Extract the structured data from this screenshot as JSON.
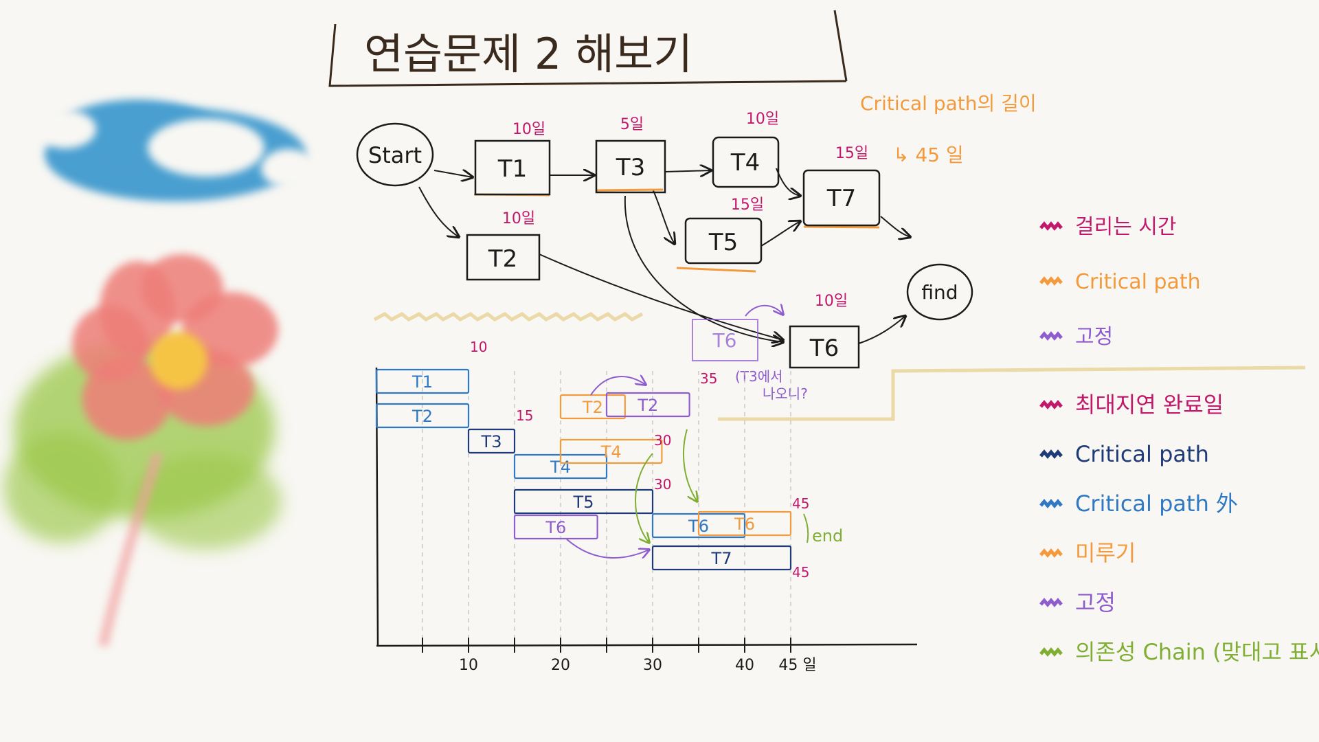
{
  "title": "연습문제 2 해보기",
  "nodes": [
    {
      "id": "start",
      "label": "Start"
    },
    {
      "id": "t1",
      "label": "T1",
      "duration": "10일"
    },
    {
      "id": "t2",
      "label": "T2",
      "duration": "10일"
    },
    {
      "id": "t3",
      "label": "T3",
      "duration": "5일"
    },
    {
      "id": "t4",
      "label": "T4",
      "duration": "10일"
    },
    {
      "id": "t5",
      "label": "T5",
      "duration": "15일"
    },
    {
      "id": "t6",
      "label": "T6",
      "duration": "10일"
    },
    {
      "id": "t6_shadow",
      "label": "T6"
    },
    {
      "id": "t7",
      "label": "T7",
      "duration": "15일"
    },
    {
      "id": "end",
      "label": "find"
    }
  ],
  "edges": [
    [
      "start",
      "t1"
    ],
    [
      "start",
      "t2"
    ],
    [
      "t1",
      "t3"
    ],
    [
      "t3",
      "t4"
    ],
    [
      "t3",
      "t5"
    ],
    [
      "t4",
      "t7"
    ],
    [
      "t5",
      "t7"
    ],
    [
      "t2",
      "t6"
    ],
    [
      "t3",
      "t6"
    ],
    [
      "t7",
      "end"
    ],
    [
      "t6",
      "end"
    ]
  ],
  "critical_note": {
    "line1": "Critical path의 길이",
    "line2": "↳ 45 일"
  },
  "t6_note": {
    "line1": "(T3에서",
    "line2": "나오니?"
  },
  "legend_top": [
    {
      "color": "#c2186b",
      "label": "걸리는 시간"
    },
    {
      "color": "#f39a3c",
      "label": "Critical path"
    },
    {
      "color": "#8e5ccf",
      "label": "고정"
    }
  ],
  "legend_bottom": [
    {
      "color": "#c2186b",
      "label": "최대지연 완료일"
    },
    {
      "color": "#1f3a78",
      "label": "Critical path"
    },
    {
      "color": "#2f78c4",
      "label": "Critical path 外"
    },
    {
      "color": "#f39a3c",
      "label": "미루기"
    },
    {
      "color": "#8e5ccf",
      "label": "고정"
    },
    {
      "color": "#7fae33",
      "label": "의존성 Chain (맞대고 표시)"
    }
  ],
  "gantt": {
    "x_ticks": [
      "10",
      "20",
      "30",
      "40",
      "45 일"
    ],
    "bars": [
      {
        "label": "T1",
        "color": "#2f78c4"
      },
      {
        "label": "T2",
        "color": "#2f78c4"
      },
      {
        "label": "T3",
        "color": "#1f3a78"
      },
      {
        "label": "T4",
        "color": "#2f78c4"
      },
      {
        "label": "T5",
        "color": "#1f3a78"
      },
      {
        "label": "T6",
        "color": "#8e5ccf"
      },
      {
        "label": "T6",
        "color": "#2f78c4"
      },
      {
        "label": "T7",
        "color": "#1f3a78"
      },
      {
        "label": "T2",
        "color": "#f39a3c"
      },
      {
        "label": "T2",
        "color": "#8e5ccf"
      },
      {
        "label": "T4",
        "color": "#f39a3c"
      },
      {
        "label": "T6",
        "color": "#f39a3c"
      }
    ],
    "finish_labels": [
      "10",
      "15",
      "30",
      "30",
      "35",
      "45",
      "45"
    ],
    "end_label": "end"
  },
  "colors": {
    "ink": "#1b1b1b",
    "magenta": "#c2186b",
    "orange": "#f39a3c",
    "purple": "#8e5ccf",
    "navy": "#1f3a78",
    "blue": "#2f78c4",
    "green": "#7fae33",
    "sky": "#4a9fd0",
    "petal": "#ee7e78",
    "leaf": "#9bc84a"
  }
}
